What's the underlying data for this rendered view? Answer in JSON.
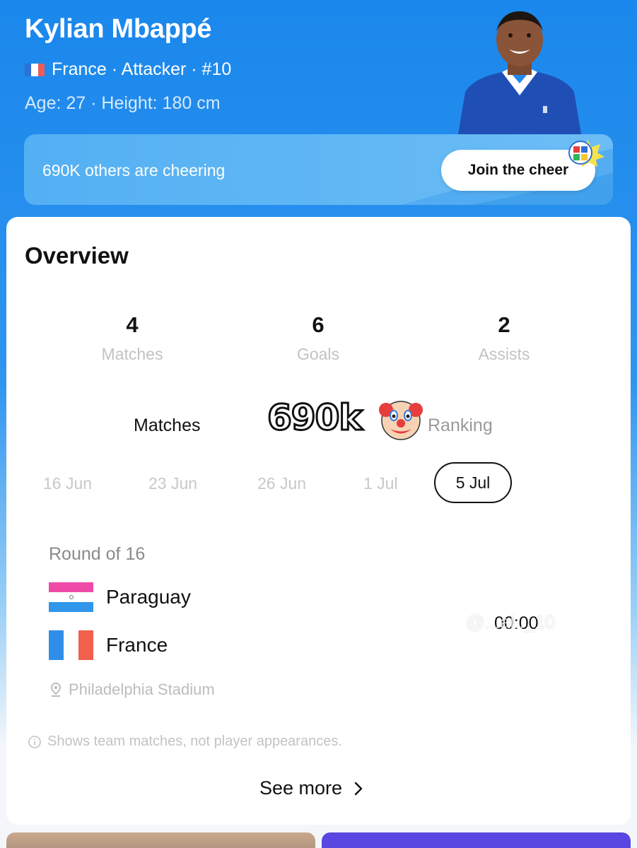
{
  "player": {
    "name": "Kylian Mbappé",
    "meta": "France · Attacker · #10",
    "sub": "Age: 27 · Height: 180 cm"
  },
  "cheer": {
    "text": "690K others are cheering",
    "button": "Join the cheer"
  },
  "overview": {
    "title": "Overview",
    "stats": [
      {
        "value": "4",
        "label": "Matches"
      },
      {
        "value": "6",
        "label": "Goals"
      },
      {
        "value": "2",
        "label": "Assists"
      }
    ]
  },
  "tabs": {
    "matches": "Matches",
    "ranking": "Ranking"
  },
  "overlay": {
    "text": "690k"
  },
  "dates": [
    "16 Jun",
    "23 Jun",
    "26 Jun",
    "1 Jul",
    "5 Jul"
  ],
  "match": {
    "round": "Round of 16",
    "home": "Paraguay",
    "away": "France",
    "time": "00:00",
    "venue": "Philadelphia Stadium"
  },
  "note": "Shows team matches, not player appearances.",
  "see_more": "See more",
  "watermark": "@...al.._10",
  "colors": {
    "brand_blue": "#1a87ec",
    "france_blue": "#2f8fe8",
    "france_red": "#f2604d",
    "paraguay_pink": "#f04aa8",
    "paraguay_blue": "#2f96ea"
  }
}
